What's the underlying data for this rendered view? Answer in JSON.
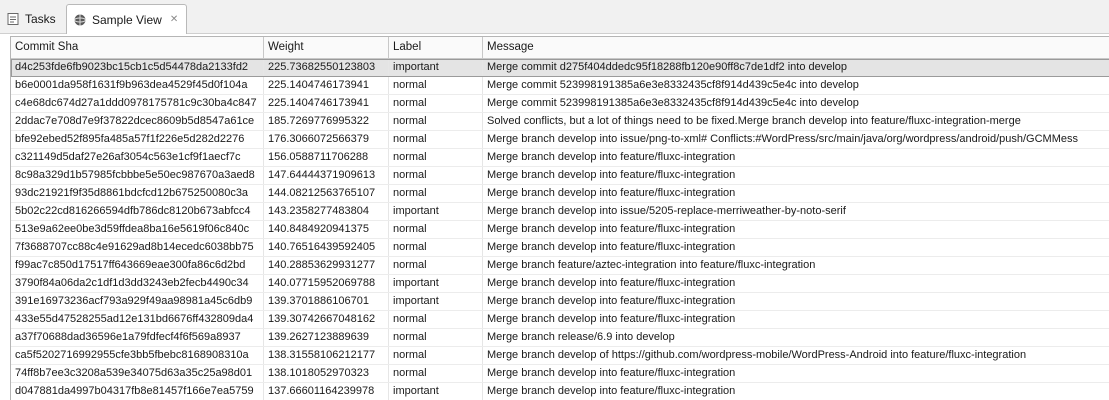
{
  "tabs": [
    {
      "label": "Tasks",
      "icon": "tasks-icon"
    },
    {
      "label": "Sample View",
      "icon": "sample-view-icon",
      "close": "✕"
    }
  ],
  "columns": [
    "Commit Sha",
    "Weight",
    "Label",
    "Message"
  ],
  "rows": [
    {
      "sha": "d4c253fde6fb9023bc15cb1c5d54478da2133fd2",
      "weight": "225.73682550123803",
      "label": "important",
      "message": "Merge commit d275f404ddedc95f18288fb120e90ff8c7de1df2 into develop"
    },
    {
      "sha": "b6e0001da958f1631f9b963dea4529f45d0f104a",
      "weight": "225.1404746173941",
      "label": "normal",
      "message": "Merge commit 523998191385a6e3e8332435cf8f914d439c5e4c into develop"
    },
    {
      "sha": "c4e68dc674d27a1ddd0978175781c9c30ba4c847",
      "weight": "225.1404746173941",
      "label": "normal",
      "message": "Merge commit 523998191385a6e3e8332435cf8f914d439c5e4c into develop"
    },
    {
      "sha": "2ddac7e708d7e9f37822dcec8609b5d8547a61ce",
      "weight": "185.7269776995322",
      "label": "normal",
      "message": "Solved conflicts, but a lot of things need to be fixed.Merge branch develop into feature/fluxc-integration-merge"
    },
    {
      "sha": "bfe92ebed52f895fa485a57f1f226e5d282d2276",
      "weight": "176.3066072566379",
      "label": "normal",
      "message": "Merge branch develop into issue/png-to-xml# Conflicts:#WordPress/src/main/java/org/wordpress/android/push/GCMMess"
    },
    {
      "sha": "c321149d5daf27e26af3054c563e1cf9f1aecf7c",
      "weight": "156.0588711706288",
      "label": "normal",
      "message": "Merge branch develop into feature/fluxc-integration"
    },
    {
      "sha": "8c98a329d1b57985fcbbbe5e50ec987670a3aed8",
      "weight": "147.64444371909613",
      "label": "normal",
      "message": "Merge branch develop into feature/fluxc-integration"
    },
    {
      "sha": "93dc21921f9f35d8861bdcfcd12b675250080c3a",
      "weight": "144.08212563765107",
      "label": "normal",
      "message": "Merge branch develop into feature/fluxc-integration"
    },
    {
      "sha": "5b02c22cd816266594dfb786dc8120b673abfcc4",
      "weight": "143.2358277483804",
      "label": "important",
      "message": "Merge branch develop into issue/5205-replace-merriweather-by-noto-serif"
    },
    {
      "sha": "513e9a62ee0be3d59ffdea8ba16e5619f06c840c",
      "weight": "140.8484920941375",
      "label": "normal",
      "message": "Merge branch develop into feature/fluxc-integration"
    },
    {
      "sha": "7f3688707cc88c4e91629ad8b14ecedc6038bb75",
      "weight": "140.76516439592405",
      "label": "normal",
      "message": "Merge branch develop into feature/fluxc-integration"
    },
    {
      "sha": "f99ac7c850d17517ff643669eae300fa86c6d2bd",
      "weight": "140.28853629931277",
      "label": "normal",
      "message": "Merge branch feature/aztec-integration into feature/fluxc-integration"
    },
    {
      "sha": "3790f84a06da2c1df1d3dd3243eb2fecb4490c34",
      "weight": "140.07715952069788",
      "label": "important",
      "message": "Merge branch develop into feature/fluxc-integration"
    },
    {
      "sha": "391e16973236acf793a929f49aa98981a45c6db9",
      "weight": "139.3701886106701",
      "label": "important",
      "message": "Merge branch develop into feature/fluxc-integration"
    },
    {
      "sha": "433e55d47528255ad12e131bd6676ff432809da4",
      "weight": "139.30742667048162",
      "label": "normal",
      "message": "Merge branch develop into feature/fluxc-integration"
    },
    {
      "sha": "a37f70688dad36596e1a79fdfecf4f6f569a8937",
      "weight": "139.2627123889639",
      "label": "normal",
      "message": "Merge branch release/6.9 into develop"
    },
    {
      "sha": "ca5f5202716992955cfe3bb5fbebc8168908310a",
      "weight": "138.31558106212177",
      "label": "normal",
      "message": "Merge branch develop of https://github.com/wordpress-mobile/WordPress-Android into feature/fluxc-integration"
    },
    {
      "sha": "74ff8b7ee3c3208a539e34075d63a35c25a98d01",
      "weight": "138.1018052970323",
      "label": "normal",
      "message": "Merge branch develop into feature/fluxc-integration"
    },
    {
      "sha": "d047881da4997b04317fb8e81457f166e7ea5759",
      "weight": "137.66601164239978",
      "label": "important",
      "message": "Merge branch develop into feature/fluxc-integration"
    }
  ],
  "selected_row": 0
}
